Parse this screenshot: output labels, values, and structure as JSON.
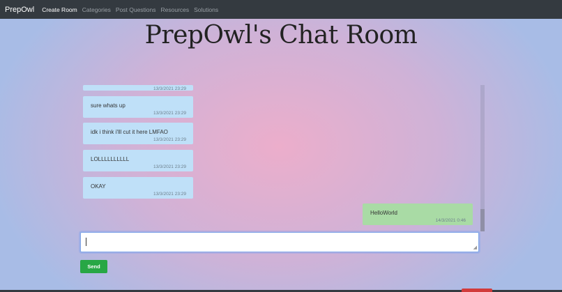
{
  "navbar": {
    "brand": "PrepOwl",
    "links": [
      "Create Room",
      "Categories",
      "Post Questions",
      "Resources",
      "Solutions"
    ]
  },
  "title": "PrepOwl's Chat Room",
  "messages": [
    {
      "text": "",
      "time": "13/3/2021 23:29"
    },
    {
      "text": "sure whats up",
      "time": "13/3/2021 23:29"
    },
    {
      "text": "idk i think i'lll cut it here LMFAO",
      "time": "13/3/2021 23:29"
    },
    {
      "text": "LOLLLLLLLLLL",
      "time": "13/3/2021 23:29"
    },
    {
      "text": "OKAY",
      "time": "13/3/2021 23:29"
    },
    {
      "text": "HelloWorld",
      "time": "14/3/2021 0:46"
    }
  ],
  "input": {
    "value": "",
    "placeholder": ""
  },
  "send_label": "Send",
  "colors": {
    "navbar": "#343a40",
    "received": "#bfe0f8",
    "sent": "#a9dba5",
    "send_button": "#28a745"
  }
}
